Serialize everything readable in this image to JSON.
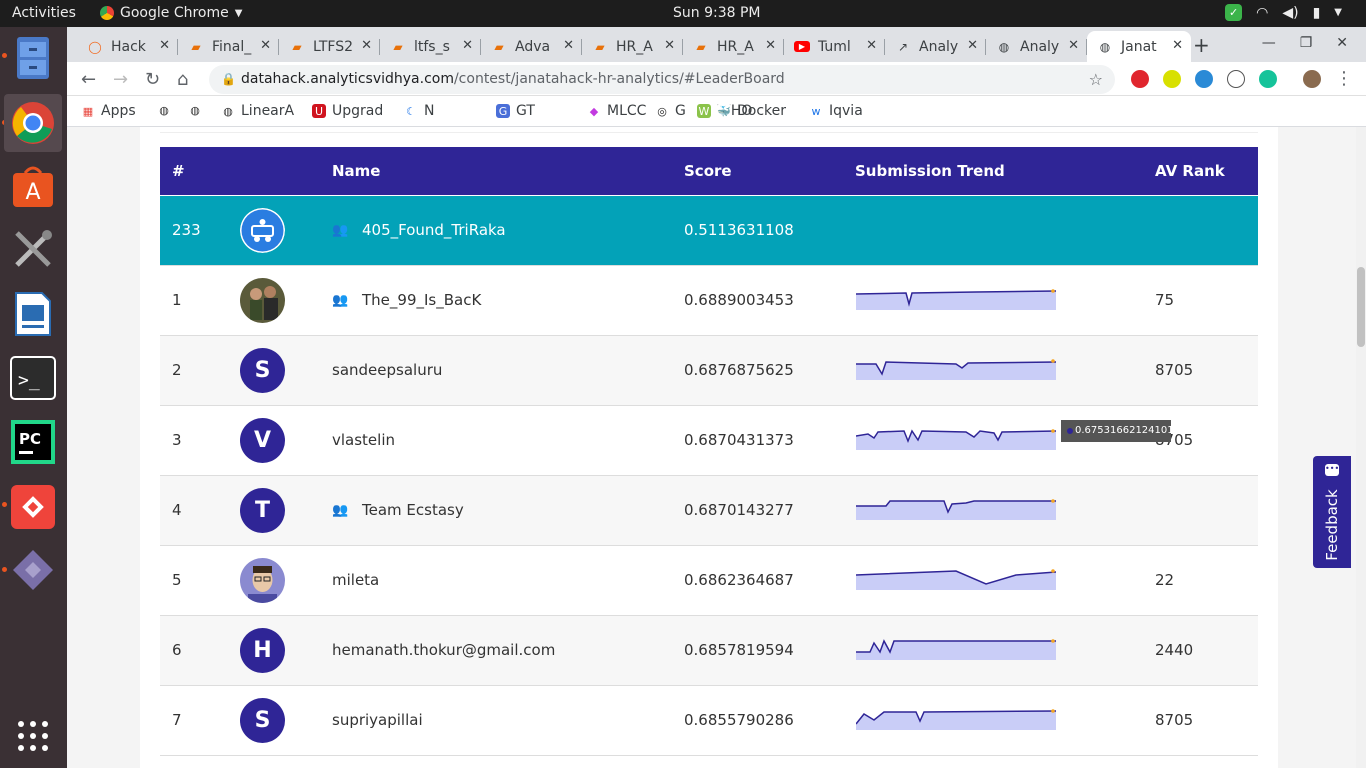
{
  "system_bar": {
    "activities": "Activities",
    "app_name": "Google Chrome",
    "clock": "Sun  9:38 PM"
  },
  "browser": {
    "tabs": [
      {
        "label": "Hack",
        "icon": "hackerearth-icon",
        "color": "#f26b21"
      },
      {
        "label": "Final_",
        "icon": "book-icon",
        "color": "#e8710a"
      },
      {
        "label": "LTFS2",
        "icon": "book-icon",
        "color": "#e8710a"
      },
      {
        "label": "ltfs_s",
        "icon": "book-icon",
        "color": "#e8710a"
      },
      {
        "label": "Adva",
        "icon": "book-icon",
        "color": "#e8710a"
      },
      {
        "label": "HR_A",
        "icon": "book-icon",
        "color": "#e8710a"
      },
      {
        "label": "HR_A",
        "icon": "book-icon",
        "color": "#e8710a"
      },
      {
        "label": "Tuml",
        "icon": "youtube-icon",
        "color": "#ff0000"
      },
      {
        "label": "Analy",
        "icon": "chart-icon",
        "color": "#3c4043"
      },
      {
        "label": "Analy",
        "icon": "globe-icon",
        "color": "#3c4043"
      },
      {
        "label": "Janat",
        "icon": "globe-icon",
        "color": "#3c4043"
      }
    ],
    "url_host": "datahack.analyticsvidhya.com",
    "url_path": "/contest/janatahack-hr-analytics/#LeaderBoard",
    "bookmarks": [
      "Apps",
      "",
      "",
      "LinearA",
      "Upgrad",
      "N",
      "GT",
      "MLCC",
      "G",
      "WHO",
      "Docker",
      "Iqvia"
    ]
  },
  "leaderboard": {
    "headers": {
      "rank": "#",
      "name": "Name",
      "score": "Score",
      "trend": "Submission Trend",
      "av_rank": "AV Rank"
    },
    "rows": [
      {
        "rank": "233",
        "avatar": "",
        "name": "405_Found_TriRaka",
        "team": true,
        "score": "0.5113631108",
        "av_rank": "",
        "highlight": true
      },
      {
        "rank": "1",
        "avatar": "",
        "name": "The_99_Is_BacK",
        "team": true,
        "score": "0.6889003453",
        "av_rank": "75"
      },
      {
        "rank": "2",
        "avatar": "S",
        "name": "sandeepsaluru",
        "team": false,
        "score": "0.6876875625",
        "av_rank": "8705"
      },
      {
        "rank": "3",
        "avatar": "V",
        "name": "vlastelin",
        "team": false,
        "score": "0.6870431373",
        "av_rank": "8705"
      },
      {
        "rank": "4",
        "avatar": "T",
        "name": "Team Ecstasy",
        "team": true,
        "score": "0.6870143277",
        "av_rank": ""
      },
      {
        "rank": "5",
        "avatar": "",
        "name": "mileta",
        "team": false,
        "score": "0.6862364687",
        "av_rank": "22"
      },
      {
        "rank": "6",
        "avatar": "H",
        "name": "hemanath.thokur@gmail.com",
        "team": false,
        "score": "0.6857819594",
        "av_rank": "2440"
      },
      {
        "rank": "7",
        "avatar": "S",
        "name": "supriyapillai",
        "team": false,
        "score": "0.6855790286",
        "av_rank": "8705"
      }
    ],
    "tooltip": "0.675316621241011"
  },
  "feedback": {
    "label": "Feedback"
  },
  "colors": {
    "header": "#2f2596",
    "highlight_row": "#03a2b8",
    "trend_line": "#2f2596",
    "trend_fill": "#c9cdf7"
  }
}
